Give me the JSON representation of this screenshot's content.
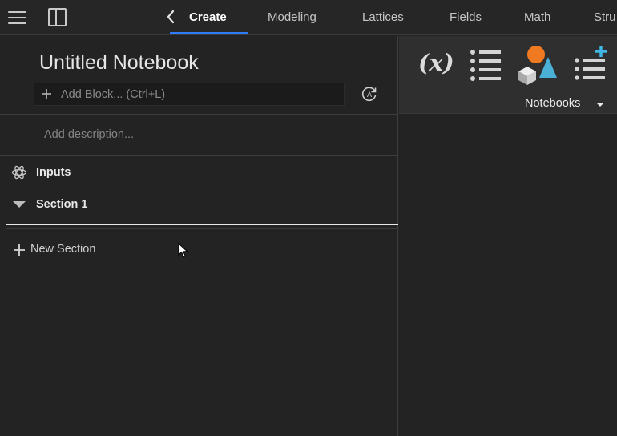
{
  "topbar": {
    "tabs": [
      {
        "label": "Create",
        "active": true
      },
      {
        "label": "Modeling"
      },
      {
        "label": "Lattices"
      },
      {
        "label": "Fields"
      },
      {
        "label": "Math"
      },
      {
        "label": "Stru"
      }
    ],
    "accent_color": "#2f7cf6"
  },
  "notebook": {
    "title": "Untitled Notebook",
    "add_block_placeholder": "Add Block... (Ctrl+L)",
    "description_placeholder": "Add description...",
    "inputs_label": "Inputs",
    "section_label": "Section 1",
    "new_section_label": "New Section"
  },
  "toolbar": {
    "fx_label": "(x)",
    "notebooks_label": "Notebooks",
    "icons": [
      "variable-icon",
      "list-icon",
      "shapes-icon",
      "add-list-icon",
      "chevron-down-icon"
    ]
  },
  "icons": {
    "menu": "hamburger-icon",
    "panel": "panel-toggle-icon",
    "back": "chevron-left-icon",
    "add": "plus-icon",
    "refresh": "auto-refresh-icon",
    "inputs": "atom-icon",
    "collapse": "caret-down-icon"
  }
}
